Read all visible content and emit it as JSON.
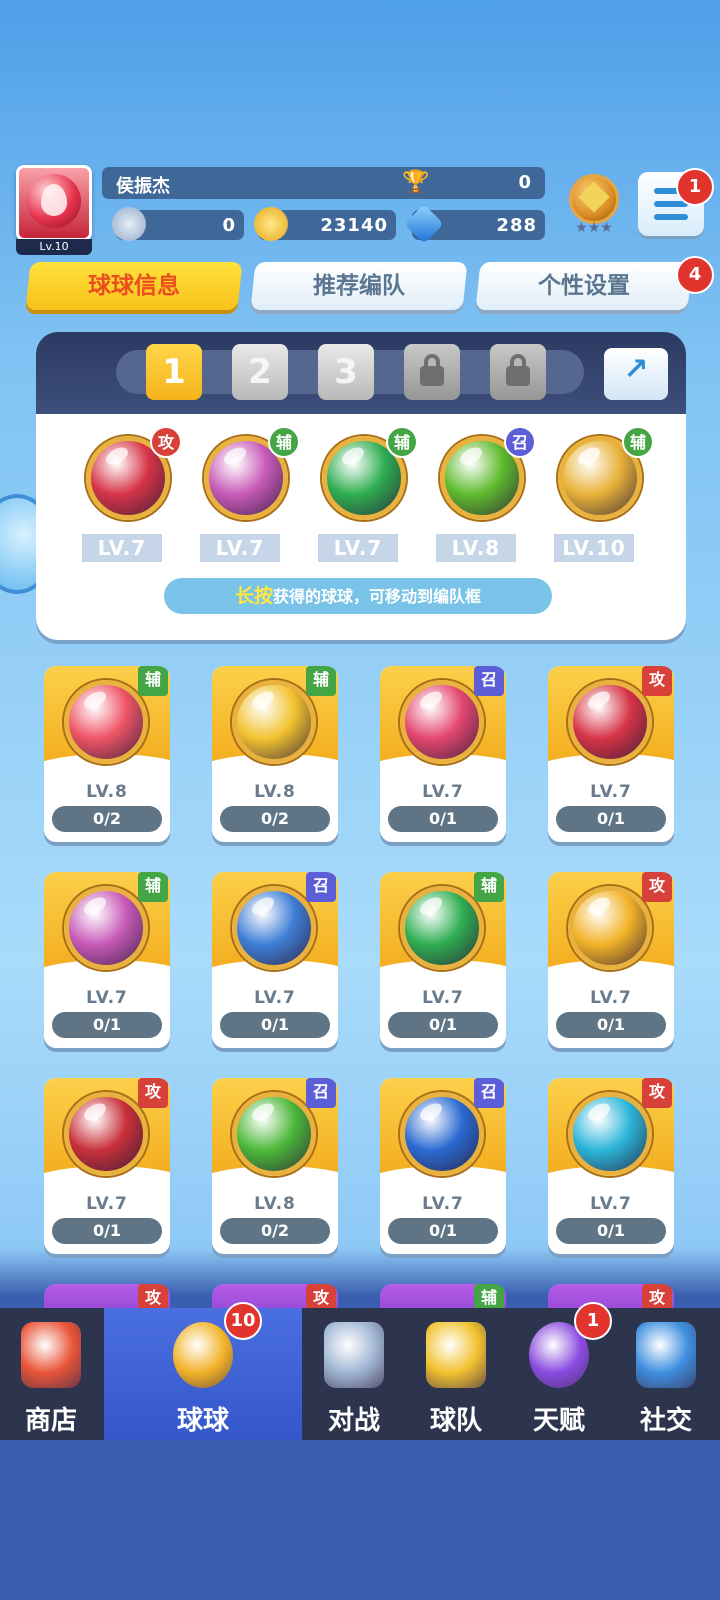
{
  "player": {
    "name": "侯振杰",
    "level": "Lv.10",
    "trophies": "0"
  },
  "resources": {
    "energy": "0",
    "gold": "23140",
    "gems": "288"
  },
  "menu_badge": "1",
  "tabs": [
    {
      "label": "球球信息",
      "active": true
    },
    {
      "label": "推荐编队",
      "active": false
    },
    {
      "label": "个性设置",
      "active": false,
      "badge": "4"
    }
  ],
  "team_slots": [
    "1",
    "2",
    "3"
  ],
  "team": [
    {
      "level": "LV.7",
      "type": "攻",
      "color": "#d63447"
    },
    {
      "level": "LV.7",
      "type": "辅",
      "color": "#c85ab8"
    },
    {
      "level": "LV.7",
      "type": "辅",
      "color": "#2fae52"
    },
    {
      "level": "LV.8",
      "type": "召",
      "color": "#5fbb2e"
    },
    {
      "level": "LV.10",
      "type": "辅",
      "color": "#e8b23a"
    }
  ],
  "hint": {
    "highlight": "长按",
    "text": "获得的球球，可移动到编队框"
  },
  "cards": [
    {
      "level": "LV.8",
      "count": "0/2",
      "type": "辅",
      "color": "#ef5466"
    },
    {
      "level": "LV.8",
      "count": "0/2",
      "type": "辅",
      "color": "#f2c230"
    },
    {
      "level": "LV.7",
      "count": "0/1",
      "type": "召",
      "color": "#e3476f"
    },
    {
      "level": "LV.7",
      "count": "0/1",
      "type": "攻",
      "color": "#d63447"
    },
    {
      "level": "LV.7",
      "count": "0/1",
      "type": "辅",
      "color": "#c85ab8"
    },
    {
      "level": "LV.7",
      "count": "0/1",
      "type": "召",
      "color": "#3f7ed6"
    },
    {
      "level": "LV.7",
      "count": "0/1",
      "type": "辅",
      "color": "#2fae52"
    },
    {
      "level": "LV.7",
      "count": "0/1",
      "type": "攻",
      "color": "#f2b227"
    },
    {
      "level": "LV.7",
      "count": "0/1",
      "type": "攻",
      "color": "#c8303a"
    },
    {
      "level": "LV.8",
      "count": "0/2",
      "type": "召",
      "color": "#4cb83a"
    },
    {
      "level": "LV.7",
      "count": "0/1",
      "type": "召",
      "color": "#2a6ad2"
    },
    {
      "level": "LV.7",
      "count": "0/1",
      "type": "攻",
      "color": "#2bb5d9"
    }
  ],
  "peek_types": [
    "攻",
    "攻",
    "辅",
    "攻"
  ],
  "nav": [
    {
      "label": "商店",
      "icon": "shop-icon"
    },
    {
      "label": "球球",
      "icon": "balls-icon",
      "selected": true,
      "badge": "10"
    },
    {
      "label": "对战",
      "icon": "crossed-swords-icon"
    },
    {
      "label": "球队",
      "icon": "whistle-icon"
    },
    {
      "label": "天赋",
      "icon": "planet-icon",
      "badge": "1"
    },
    {
      "label": "社交",
      "icon": "chat-heart-icon"
    }
  ]
}
